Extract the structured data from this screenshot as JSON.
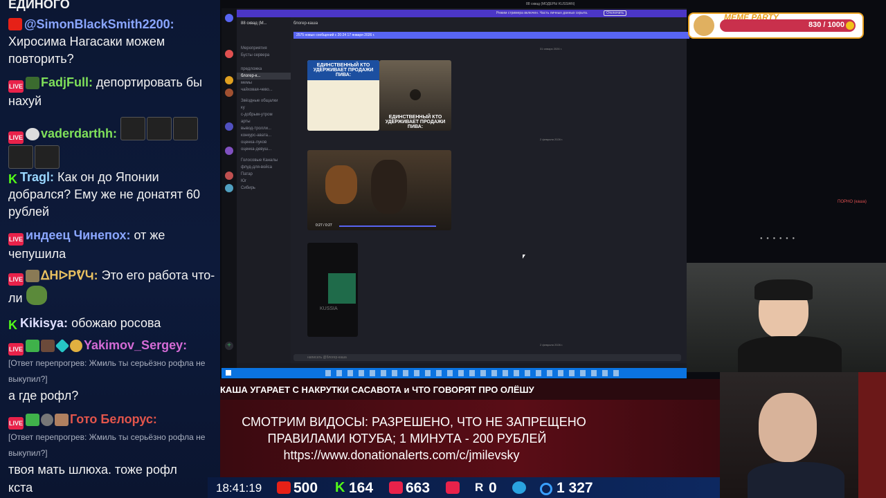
{
  "chat": {
    "top_partial": "ЕДИНОГО",
    "messages": [
      {
        "user": "@SimonBlackSmith2200:",
        "user_color": "#8aa6ff",
        "text": "Хиросима Нагасаки можем повторить?",
        "badge": "yt"
      },
      {
        "user": "FadjFull:",
        "user_color": "#7fe05a",
        "text": "депортировать бы нахуй",
        "badge": "live"
      },
      {
        "user": "vaderdarthh:",
        "user_color": "#7fe05a",
        "text": "",
        "badge": "live"
      },
      {
        "user": "Tragl:",
        "user_color": "#9ad7ff",
        "text": "Как он до Японии добрался? Ему же не донатят 60 рублей",
        "badge": "k"
      },
      {
        "user": "индеец Чинепох:",
        "user_color": "#8aa6ff",
        "text": "от же чепушила",
        "badge": "live"
      },
      {
        "user": "ᐃHᐅPᕓԿ:",
        "user_color": "#e8c060",
        "text": "Это его работа что-ли",
        "badge": "live"
      },
      {
        "user": "Kikisya:",
        "user_color": "#e0e0ff",
        "text": "обожаю росова",
        "badge": "k"
      },
      {
        "user": "Yakimov_Sergey:",
        "user_color": "#d46bd6",
        "reply": "[Ответ перепрогрев: Жмиль ты серьёзно рофла не выкупил?]",
        "text": "а где рофл?",
        "badge": "live"
      },
      {
        "user": "Гото Белорус:",
        "user_color": "#e2554b",
        "reply": "[Ответ перепрогрев: Жмиль ты серьёзно рофла не выкупил?]",
        "text": "твоя мать шлюха. тоже рофл",
        "badge": "live"
      }
    ],
    "bottom_partial": "кста"
  },
  "discord": {
    "window_title": "88 сквад (МОДЕРЫ KUSSIAN)",
    "server_name": "88 сквад (М...",
    "banner": "Режим стримера включен. Часть личных данных скрыта.",
    "banner_button": "Отключить",
    "new_messages": "2575 новых сообщений с 20:24 17 января 2026 г.",
    "channels": [
      "Мероприятия",
      "Бусты сервера",
      "предложка",
      "блогер-к...",
      "мемы",
      "чайховая-чево...",
      "Звёздные общалки",
      "ку",
      "с-добрым-утром",
      "арты",
      "вывод-тролли...",
      "конкурс-авата...",
      "оценка-луков",
      "оценка-девуш...",
      "Голосовые Каналы",
      "флуд-для-войса",
      "Патар",
      "Юг",
      "Сибирь"
    ],
    "active_channel": "блогер-каша",
    "date_1": "31 января 2026 г.",
    "date_2": "2 февраля 2026 г.",
    "date_3": "2 февраля 2026 г.",
    "thumb1_text": "ЕДИНСТВЕННЫЙ КТО УДЕРЖИВАЕТ ПРОДАЖИ ПИВА:",
    "thumb1_text2": "ЕДИНСТВЕННЫЙ КТО УДЕРЖИВАЕТ ПРОДАЖИ ПИВА:",
    "video_time": "0:27 / 0:27",
    "tiktok_label": "KUSSIA",
    "input_placeholder": "написать @блогер-каша",
    "right_panel_item": "ПОРНО (каша)"
  },
  "meme_party": {
    "label": "MEME PARTY",
    "progress": "830 / 1000",
    "fraction": 0.83
  },
  "ticker": "КАША УГАРАЕТ С НАКРУТКИ САСАВОТА и ЧТО ГОВОРЯТ ПРО ОЛЁШУ",
  "banner": {
    "line1": "СМОТРИМ ВИДОСЫ: РАЗРЕШЕНО, ЧТО НЕ ЗАПРЕЩЕНО",
    "line2": "ПРАВИЛАМИ ЮТУБА; 1 МИНУТА - 200 РУБЛЕЙ",
    "line3": "https://www.donationalerts.com/c/jmilevsky"
  },
  "status": {
    "time": "18:41:19",
    "youtube": "500",
    "kick": "164",
    "live": "663",
    "rutube": "0",
    "telegram": "",
    "viewers": "1 327"
  },
  "colors": {
    "accent": "#5865f2",
    "taskbar": "#0b73e0",
    "chat_bg": "#0c1733",
    "banner_bg": "#5a0d16"
  }
}
